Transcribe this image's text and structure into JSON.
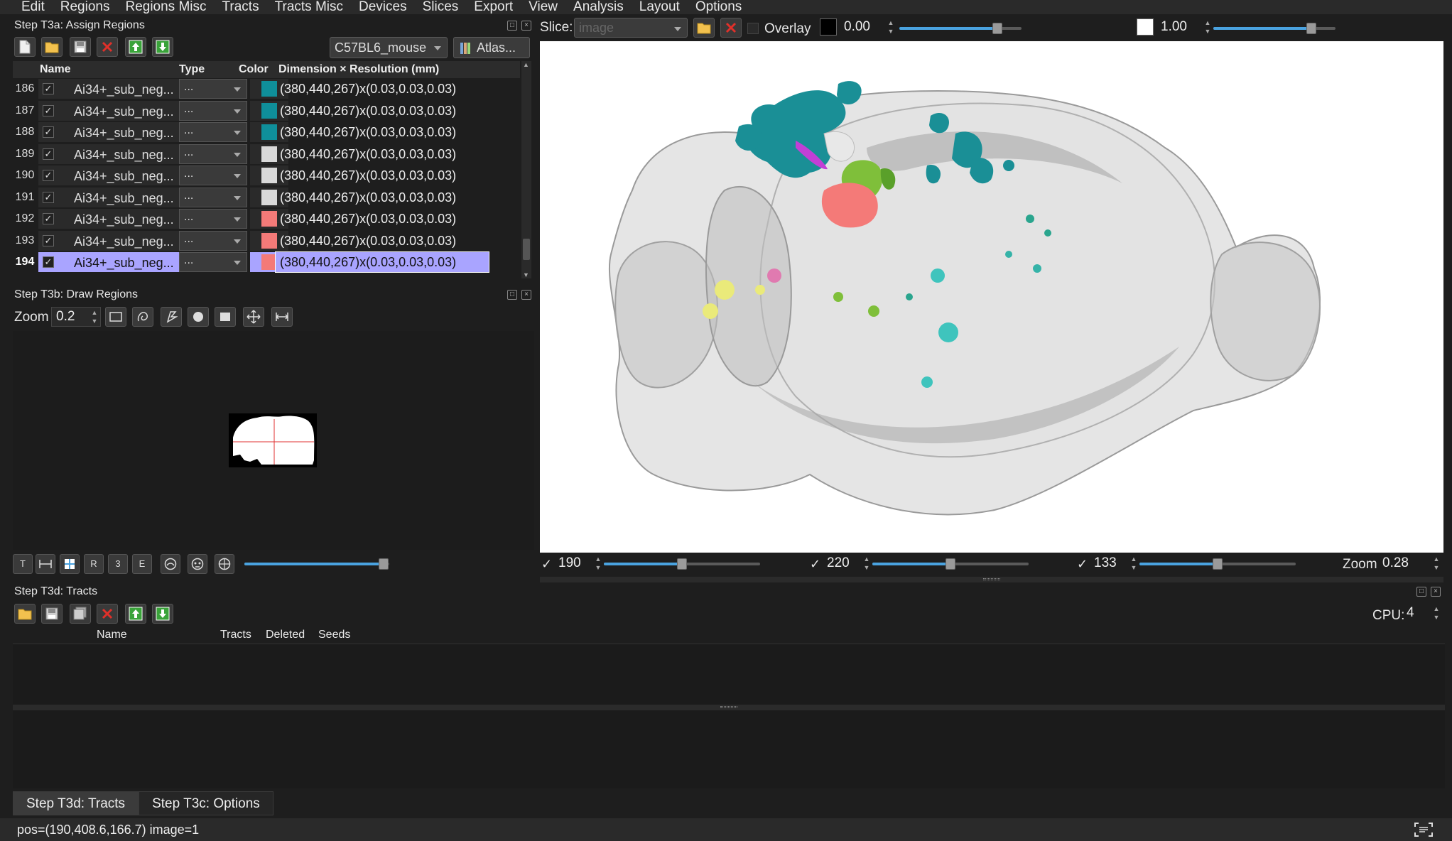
{
  "menu": [
    "Edit",
    "Regions",
    "Regions Misc",
    "Tracts",
    "Tracts Misc",
    "Devices",
    "Slices",
    "Export",
    "View",
    "Analysis",
    "Layout",
    "Options"
  ],
  "assign_panel": {
    "title": "Step T3a: Assign Regions",
    "template_select": "C57BL6_mouse",
    "atlas_button": "Atlas...",
    "columns": {
      "name": "Name",
      "type": "Type",
      "color": "Color",
      "dim": "Dimension × Resolution (mm)"
    },
    "rows": [
      {
        "num": "186",
        "name": "Ai34+_sub_neg...",
        "type": "...",
        "color": "#0f8f9a",
        "dim": "(380,440,267)x(0.03,0.03,0.03)",
        "checked": true
      },
      {
        "num": "187",
        "name": "Ai34+_sub_neg...",
        "type": "...",
        "color": "#0f8f9a",
        "dim": "(380,440,267)x(0.03,0.03,0.03)",
        "checked": true
      },
      {
        "num": "188",
        "name": "Ai34+_sub_neg...",
        "type": "...",
        "color": "#0f8f9a",
        "dim": "(380,440,267)x(0.03,0.03,0.03)",
        "checked": true
      },
      {
        "num": "189",
        "name": "Ai34+_sub_neg...",
        "type": "...",
        "color": "#d9d9d9",
        "dim": "(380,440,267)x(0.03,0.03,0.03)",
        "checked": true
      },
      {
        "num": "190",
        "name": "Ai34+_sub_neg...",
        "type": "...",
        "color": "#d9d9d9",
        "dim": "(380,440,267)x(0.03,0.03,0.03)",
        "checked": true
      },
      {
        "num": "191",
        "name": "Ai34+_sub_neg...",
        "type": "...",
        "color": "#d9d9d9",
        "dim": "(380,440,267)x(0.03,0.03,0.03)",
        "checked": true
      },
      {
        "num": "192",
        "name": "Ai34+_sub_neg...",
        "type": "...",
        "color": "#f47a78",
        "dim": "(380,440,267)x(0.03,0.03,0.03)",
        "checked": true
      },
      {
        "num": "193",
        "name": "Ai34+_sub_neg...",
        "type": "...",
        "color": "#f47a78",
        "dim": "(380,440,267)x(0.03,0.03,0.03)",
        "checked": true
      },
      {
        "num": "194",
        "name": "Ai34+_sub_neg...",
        "type": "...",
        "color": "#f47a78",
        "dim": "(380,440,267)x(0.03,0.03,0.03)",
        "checked": true
      }
    ]
  },
  "draw_panel": {
    "title": "Step T3b: Draw Regions",
    "zoom_label": "Zoom",
    "zoom_value": "0.2",
    "view_buttons": [
      "T",
      "R",
      "3",
      "E"
    ],
    "slice_position": 0.96
  },
  "slice_bar": {
    "label": "Slice:",
    "slice_value": "image",
    "overlay_label": "Overlay",
    "min_value": "0.00",
    "max_value": "1.00",
    "min_position": 0.8,
    "max_position": 0.8
  },
  "view_controls": {
    "x": {
      "check": "✓",
      "value": "190",
      "position": 0.5
    },
    "y": {
      "check": "✓",
      "value": "220",
      "position": 0.5
    },
    "z": {
      "check": "✓",
      "value": "133",
      "position": 0.5
    },
    "zoom_label": "Zoom",
    "zoom_value": "0.28"
  },
  "tracts_panel": {
    "title": "Step T3d: Tracts",
    "cpu_label": "CPU:",
    "cpu_value": "4",
    "columns": {
      "name": "Name",
      "tracts": "Tracts",
      "deleted": "Deleted",
      "seeds": "Seeds"
    }
  },
  "tabs": [
    "Step T3d: Tracts",
    "Step T3c: Options"
  ],
  "status": "pos=(190,408.6,166.7) image=1",
  "colors": {
    "accent": "#4aa3e0",
    "selection": "#a9a4ff",
    "teal": "#0f8f9a",
    "green": "#7fbf3a",
    "salmon": "#f47a78"
  }
}
